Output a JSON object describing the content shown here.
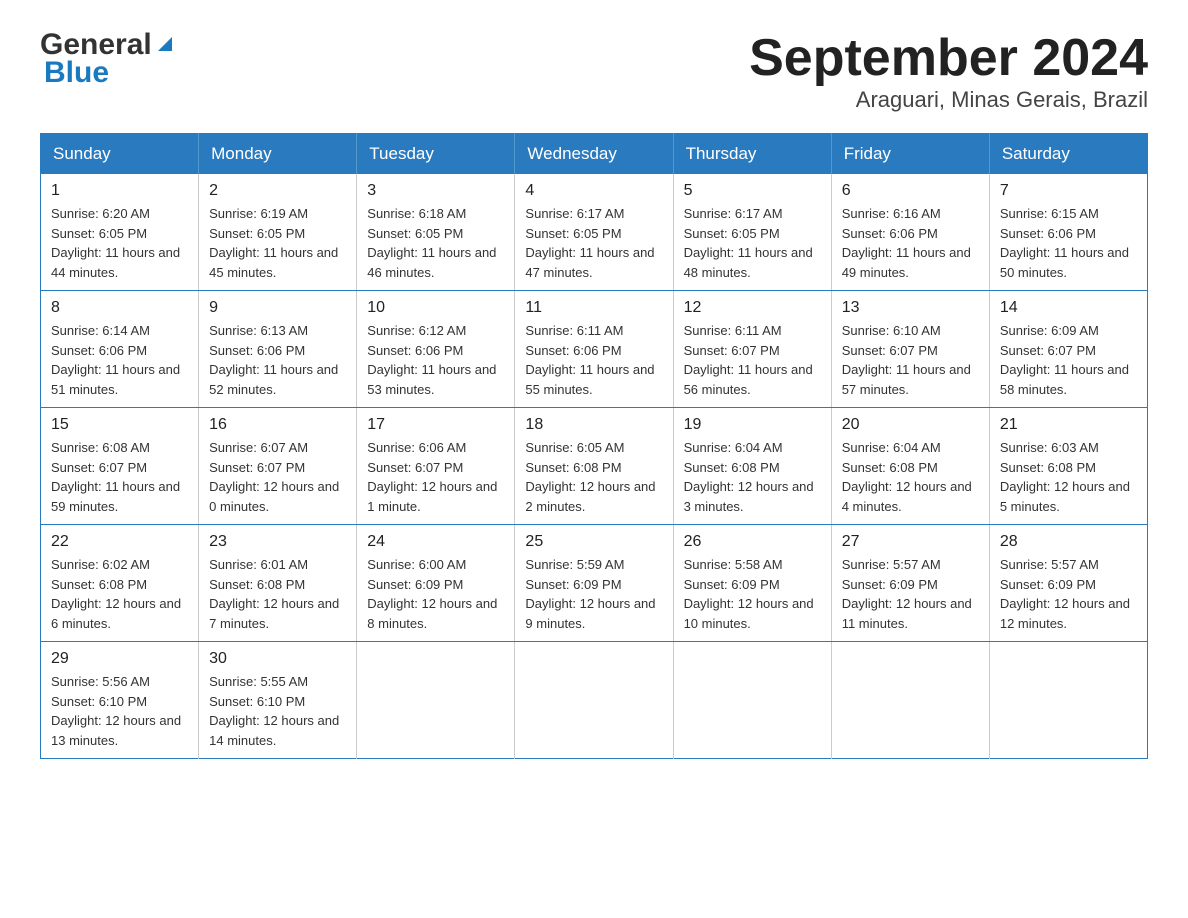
{
  "logo": {
    "general": "General",
    "blue": "Blue"
  },
  "title": "September 2024",
  "subtitle": "Araguari, Minas Gerais, Brazil",
  "days_header": [
    "Sunday",
    "Monday",
    "Tuesday",
    "Wednesday",
    "Thursday",
    "Friday",
    "Saturday"
  ],
  "weeks": [
    [
      {
        "day": "1",
        "sunrise": "6:20 AM",
        "sunset": "6:05 PM",
        "daylight": "11 hours and 44 minutes."
      },
      {
        "day": "2",
        "sunrise": "6:19 AM",
        "sunset": "6:05 PM",
        "daylight": "11 hours and 45 minutes."
      },
      {
        "day": "3",
        "sunrise": "6:18 AM",
        "sunset": "6:05 PM",
        "daylight": "11 hours and 46 minutes."
      },
      {
        "day": "4",
        "sunrise": "6:17 AM",
        "sunset": "6:05 PM",
        "daylight": "11 hours and 47 minutes."
      },
      {
        "day": "5",
        "sunrise": "6:17 AM",
        "sunset": "6:05 PM",
        "daylight": "11 hours and 48 minutes."
      },
      {
        "day": "6",
        "sunrise": "6:16 AM",
        "sunset": "6:06 PM",
        "daylight": "11 hours and 49 minutes."
      },
      {
        "day": "7",
        "sunrise": "6:15 AM",
        "sunset": "6:06 PM",
        "daylight": "11 hours and 50 minutes."
      }
    ],
    [
      {
        "day": "8",
        "sunrise": "6:14 AM",
        "sunset": "6:06 PM",
        "daylight": "11 hours and 51 minutes."
      },
      {
        "day": "9",
        "sunrise": "6:13 AM",
        "sunset": "6:06 PM",
        "daylight": "11 hours and 52 minutes."
      },
      {
        "day": "10",
        "sunrise": "6:12 AM",
        "sunset": "6:06 PM",
        "daylight": "11 hours and 53 minutes."
      },
      {
        "day": "11",
        "sunrise": "6:11 AM",
        "sunset": "6:06 PM",
        "daylight": "11 hours and 55 minutes."
      },
      {
        "day": "12",
        "sunrise": "6:11 AM",
        "sunset": "6:07 PM",
        "daylight": "11 hours and 56 minutes."
      },
      {
        "day": "13",
        "sunrise": "6:10 AM",
        "sunset": "6:07 PM",
        "daylight": "11 hours and 57 minutes."
      },
      {
        "day": "14",
        "sunrise": "6:09 AM",
        "sunset": "6:07 PM",
        "daylight": "11 hours and 58 minutes."
      }
    ],
    [
      {
        "day": "15",
        "sunrise": "6:08 AM",
        "sunset": "6:07 PM",
        "daylight": "11 hours and 59 minutes."
      },
      {
        "day": "16",
        "sunrise": "6:07 AM",
        "sunset": "6:07 PM",
        "daylight": "12 hours and 0 minutes."
      },
      {
        "day": "17",
        "sunrise": "6:06 AM",
        "sunset": "6:07 PM",
        "daylight": "12 hours and 1 minute."
      },
      {
        "day": "18",
        "sunrise": "6:05 AM",
        "sunset": "6:08 PM",
        "daylight": "12 hours and 2 minutes."
      },
      {
        "day": "19",
        "sunrise": "6:04 AM",
        "sunset": "6:08 PM",
        "daylight": "12 hours and 3 minutes."
      },
      {
        "day": "20",
        "sunrise": "6:04 AM",
        "sunset": "6:08 PM",
        "daylight": "12 hours and 4 minutes."
      },
      {
        "day": "21",
        "sunrise": "6:03 AM",
        "sunset": "6:08 PM",
        "daylight": "12 hours and 5 minutes."
      }
    ],
    [
      {
        "day": "22",
        "sunrise": "6:02 AM",
        "sunset": "6:08 PM",
        "daylight": "12 hours and 6 minutes."
      },
      {
        "day": "23",
        "sunrise": "6:01 AM",
        "sunset": "6:08 PM",
        "daylight": "12 hours and 7 minutes."
      },
      {
        "day": "24",
        "sunrise": "6:00 AM",
        "sunset": "6:09 PM",
        "daylight": "12 hours and 8 minutes."
      },
      {
        "day": "25",
        "sunrise": "5:59 AM",
        "sunset": "6:09 PM",
        "daylight": "12 hours and 9 minutes."
      },
      {
        "day": "26",
        "sunrise": "5:58 AM",
        "sunset": "6:09 PM",
        "daylight": "12 hours and 10 minutes."
      },
      {
        "day": "27",
        "sunrise": "5:57 AM",
        "sunset": "6:09 PM",
        "daylight": "12 hours and 11 minutes."
      },
      {
        "day": "28",
        "sunrise": "5:57 AM",
        "sunset": "6:09 PM",
        "daylight": "12 hours and 12 minutes."
      }
    ],
    [
      {
        "day": "29",
        "sunrise": "5:56 AM",
        "sunset": "6:10 PM",
        "daylight": "12 hours and 13 minutes."
      },
      {
        "day": "30",
        "sunrise": "5:55 AM",
        "sunset": "6:10 PM",
        "daylight": "12 hours and 14 minutes."
      },
      null,
      null,
      null,
      null,
      null
    ]
  ],
  "labels": {
    "sunrise": "Sunrise:",
    "sunset": "Sunset:",
    "daylight": "Daylight:"
  }
}
